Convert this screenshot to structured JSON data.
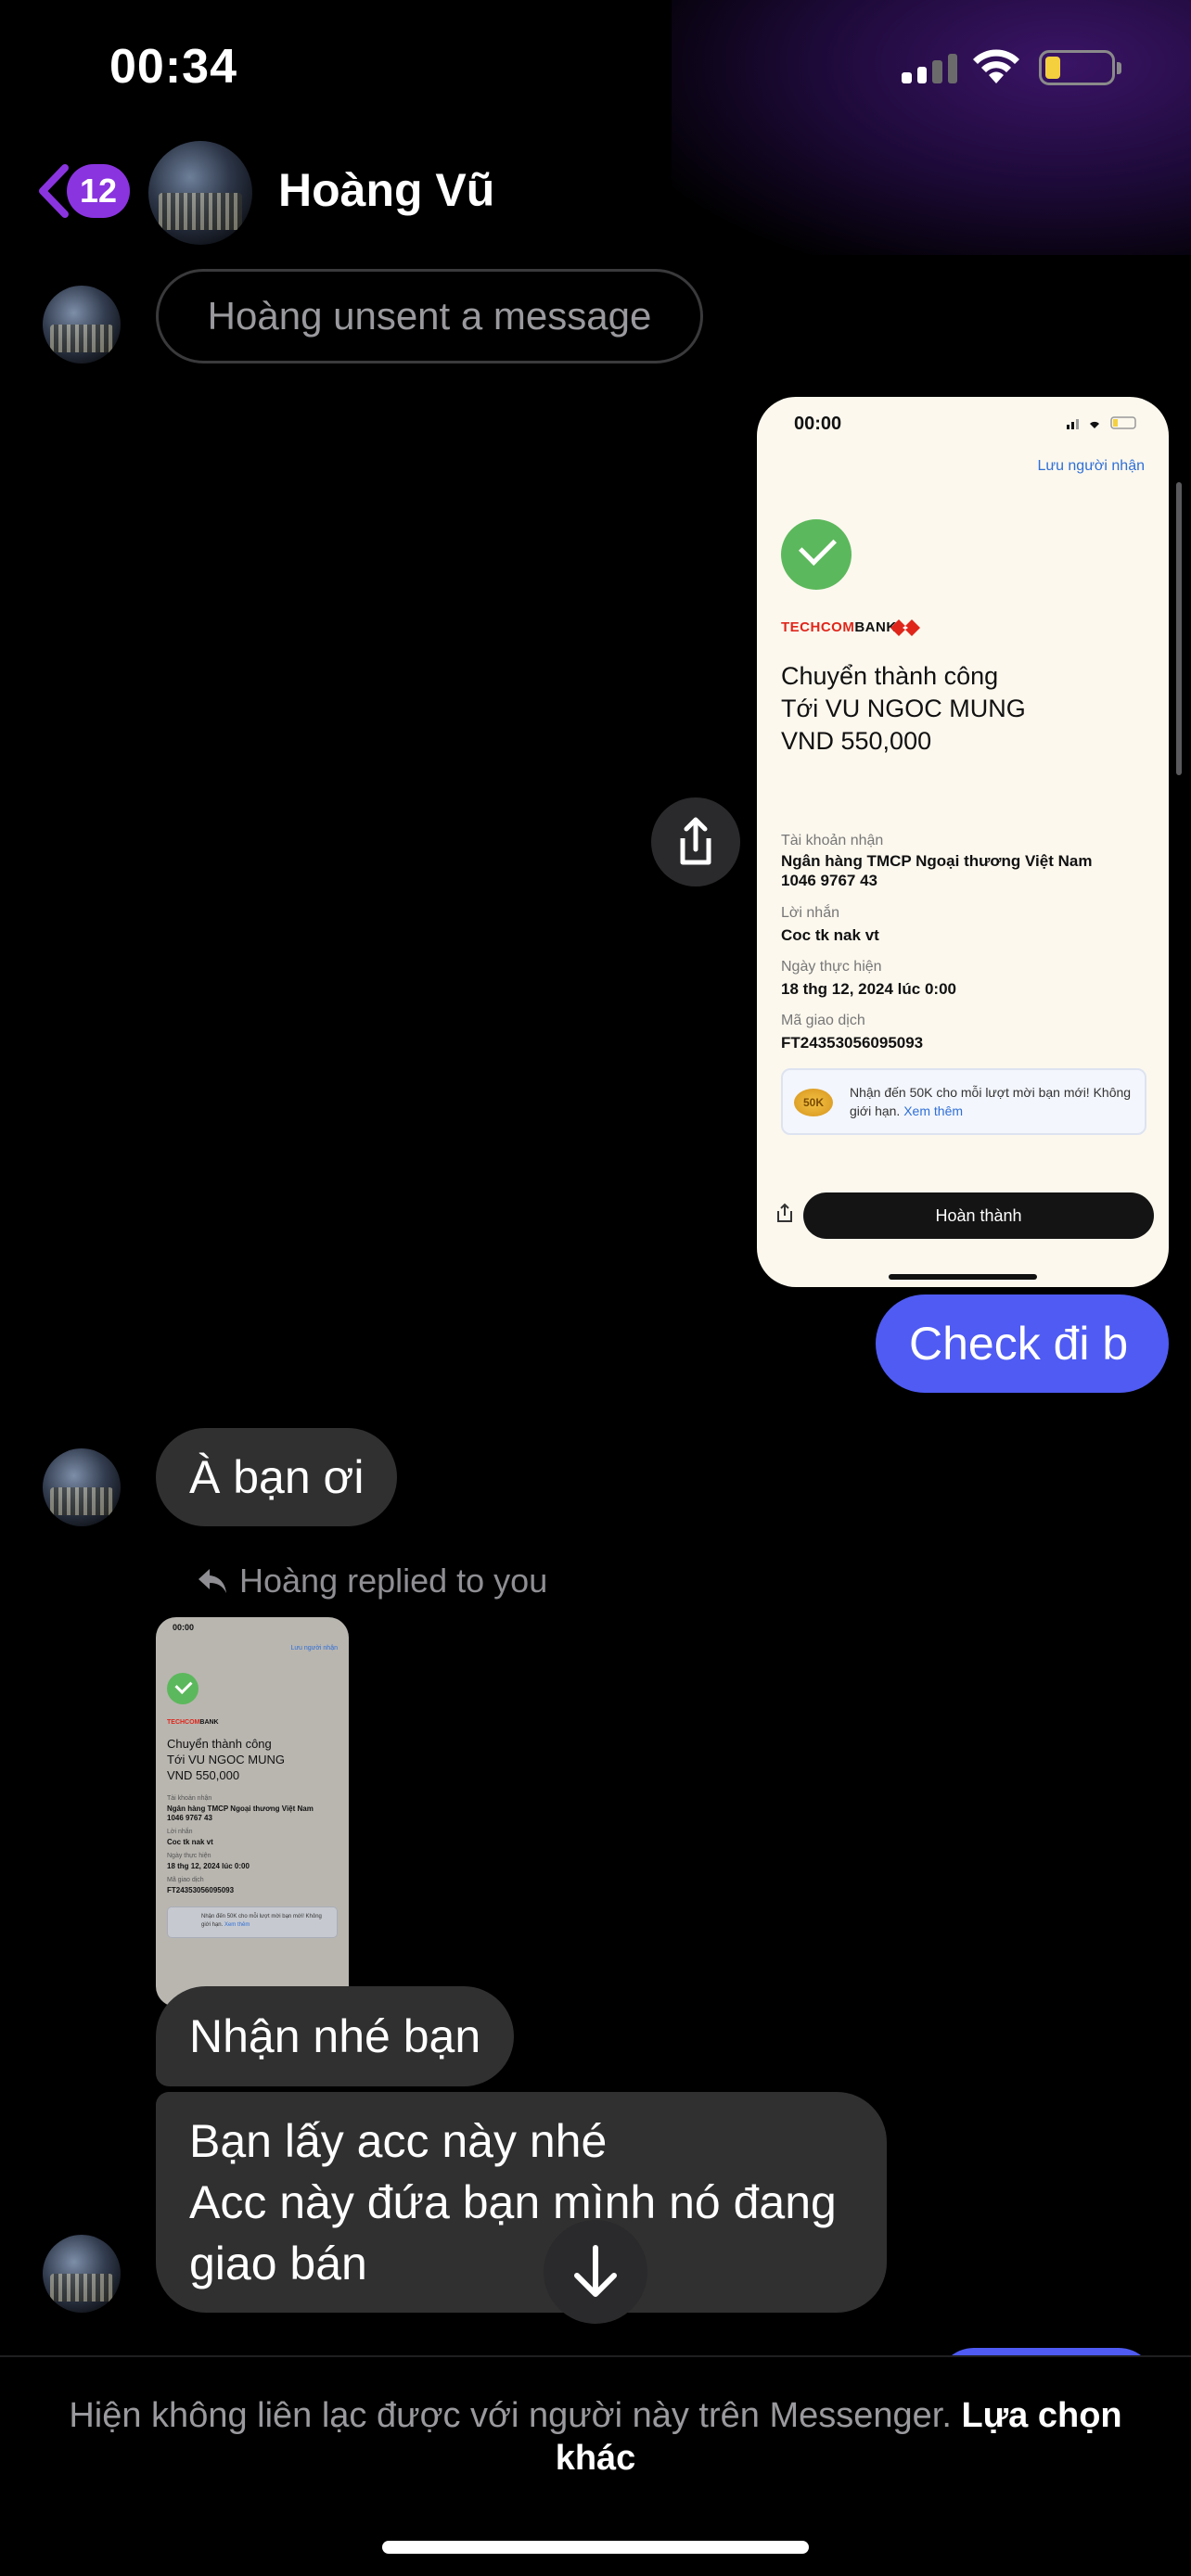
{
  "status_bar": {
    "time": "00:34"
  },
  "header": {
    "back_badge": "12",
    "contact_name": "Hoàng Vũ"
  },
  "messages": {
    "unsent_notice": "Hoàng unsent a message",
    "sent_check": "Check đi b",
    "recv_a_ban_oi": "À bạn ơi",
    "reply_indicator": "Hoàng replied to you",
    "recv_nhan_nhe": "Nhận nhé bạn",
    "recv_long_line1": "Bạn lấy acc này nhé",
    "recv_long_line2": "Acc này đứa bạn mình nó đang",
    "recv_long_line3": "giao bán"
  },
  "receipt": {
    "time": "00:00",
    "save_recipient": "Lưu người nhận",
    "bank_red": "TECHCOM",
    "bank_black": "BANK",
    "title_line1": "Chuyển thành công",
    "title_line2": "Tới VU NGOC MUNG",
    "title_line3": "VND 550,000",
    "account_label": "Tài khoản nhận",
    "account_bank": "Ngân hàng TMCP Ngoại thương Việt Nam",
    "account_number": "1046 9767 43",
    "note_label": "Lời nhắn",
    "note_value": "Coc tk nak vt",
    "date_label": "Ngày thực hiện",
    "date_value": "18 thg 12, 2024 lúc 0:00",
    "txn_label": "Mã giao dịch",
    "txn_value": "FT24353056095093",
    "promo_badge": "50K",
    "promo_text": "Nhận đến 50K cho mỗi lượt mời bạn mới! Không giới hạn.",
    "promo_link": "Xem thêm",
    "done_button": "Hoàn thành"
  },
  "footer": {
    "notice": "Hiện không liên lạc được với người này trên Messenger.",
    "link": "Lựa chọn khác"
  },
  "colors": {
    "sent_bubble": "#4f5bf2",
    "recv_bubble": "#303030",
    "accent_badge": "#8a34e0",
    "techcombank_red": "#e0261b"
  }
}
